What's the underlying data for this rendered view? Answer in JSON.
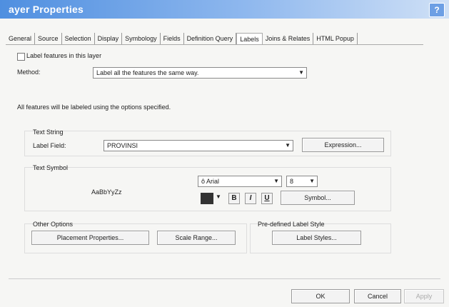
{
  "window": {
    "title": "ayer Properties",
    "help_label": "?"
  },
  "tabs": [
    "General",
    "Source",
    "Selection",
    "Display",
    "Symbology",
    "Fields",
    "Definition Query",
    "Labels",
    "Joins & Relates",
    "HTML Popup"
  ],
  "active_tab": "Labels",
  "label_features": {
    "label": "Label features in this layer",
    "checked": false
  },
  "method": {
    "label": "Method:",
    "value": "Label all the features the same way."
  },
  "info_text": "All features will be labeled using the options specified.",
  "text_string": {
    "heading": "Text String",
    "field_label": "Label Field:",
    "field_value": "PROVINSI",
    "expression_button": "Expression..."
  },
  "text_symbol": {
    "heading": "Text Symbol",
    "preview": "AaBbYyZz",
    "font_value": "Arial",
    "font_icon": "ô",
    "size_value": "8",
    "color": "#333333",
    "bold_label": "B",
    "italic_label": "I",
    "underline_label": "U",
    "symbol_button": "Symbol..."
  },
  "other_options": {
    "heading": "Other Options",
    "placement_button": "Placement Properties...",
    "scale_button": "Scale Range..."
  },
  "predefined": {
    "heading": "Pre-defined Label Style",
    "styles_button": "Label Styles..."
  },
  "footer": {
    "ok": "OK",
    "cancel": "Cancel",
    "apply": "Apply"
  }
}
